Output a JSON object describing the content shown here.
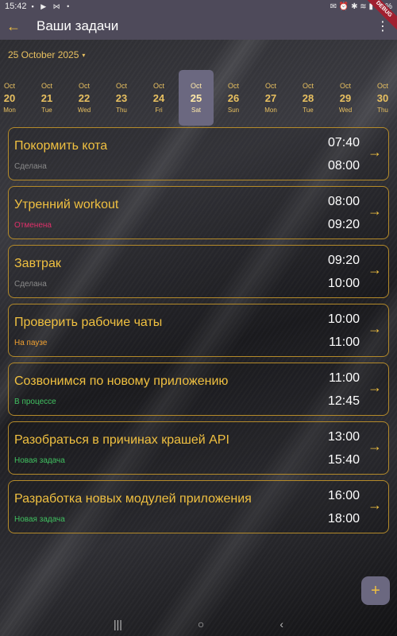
{
  "statusbar": {
    "time": "15:42",
    "notifications": "▪ ▶ ⋈ •",
    "right": "✉ ⏰ ✱ ≋ ▮",
    "battery": "62%"
  },
  "debug_label": "DEBUG",
  "appbar": {
    "back_icon": "←",
    "title": "Ваши задачи",
    "menu_icon": "⋮"
  },
  "date_select": {
    "label": "25 October 2025",
    "caret": "▾"
  },
  "days": [
    {
      "mon": "Oct",
      "num": "20",
      "dow": "Mon",
      "selected": false
    },
    {
      "mon": "Oct",
      "num": "21",
      "dow": "Tue",
      "selected": false
    },
    {
      "mon": "Oct",
      "num": "22",
      "dow": "Wed",
      "selected": false
    },
    {
      "mon": "Oct",
      "num": "23",
      "dow": "Thu",
      "selected": false
    },
    {
      "mon": "Oct",
      "num": "24",
      "dow": "Fri",
      "selected": false
    },
    {
      "mon": "Oct",
      "num": "25",
      "dow": "Sat",
      "selected": true
    },
    {
      "mon": "Oct",
      "num": "26",
      "dow": "Sun",
      "selected": false
    },
    {
      "mon": "Oct",
      "num": "27",
      "dow": "Mon",
      "selected": false
    },
    {
      "mon": "Oct",
      "num": "28",
      "dow": "Tue",
      "selected": false
    },
    {
      "mon": "Oct",
      "num": "29",
      "dow": "Wed",
      "selected": false
    },
    {
      "mon": "Oct",
      "num": "30",
      "dow": "Thu",
      "selected": false
    }
  ],
  "tasks": [
    {
      "name": "Покормить кота",
      "status": "Сделана",
      "status_color": "#8a8a8a",
      "start": "07:40",
      "end": "08:00"
    },
    {
      "name": "Утренний workout",
      "status": "Отменена",
      "status_color": "#e0306a",
      "start": "08:00",
      "end": "09:20"
    },
    {
      "name": "Завтрак",
      "status": "Сделана",
      "status_color": "#8a8a8a",
      "start": "09:20",
      "end": "10:00"
    },
    {
      "name": "Проверить рабочие чаты",
      "status": "На паузе",
      "status_color": "#f0a030",
      "start": "10:00",
      "end": "11:00"
    },
    {
      "name": "Созвонимся по новому приложению",
      "status": "В процессе",
      "status_color": "#40c060",
      "start": "11:00",
      "end": "12:45"
    },
    {
      "name": "Разобраться в причинах крашей API",
      "status": "Новая задача",
      "status_color": "#40c060",
      "start": "13:00",
      "end": "15:40"
    },
    {
      "name": "Разработка новых модулей приложения",
      "status": "Новая задача",
      "status_color": "#40c060",
      "start": "16:00",
      "end": "18:00"
    }
  ],
  "task_arrow_icon": "→",
  "fab_icon": "+",
  "navbar": {
    "recent": "|||",
    "home": "○",
    "back": "‹"
  }
}
